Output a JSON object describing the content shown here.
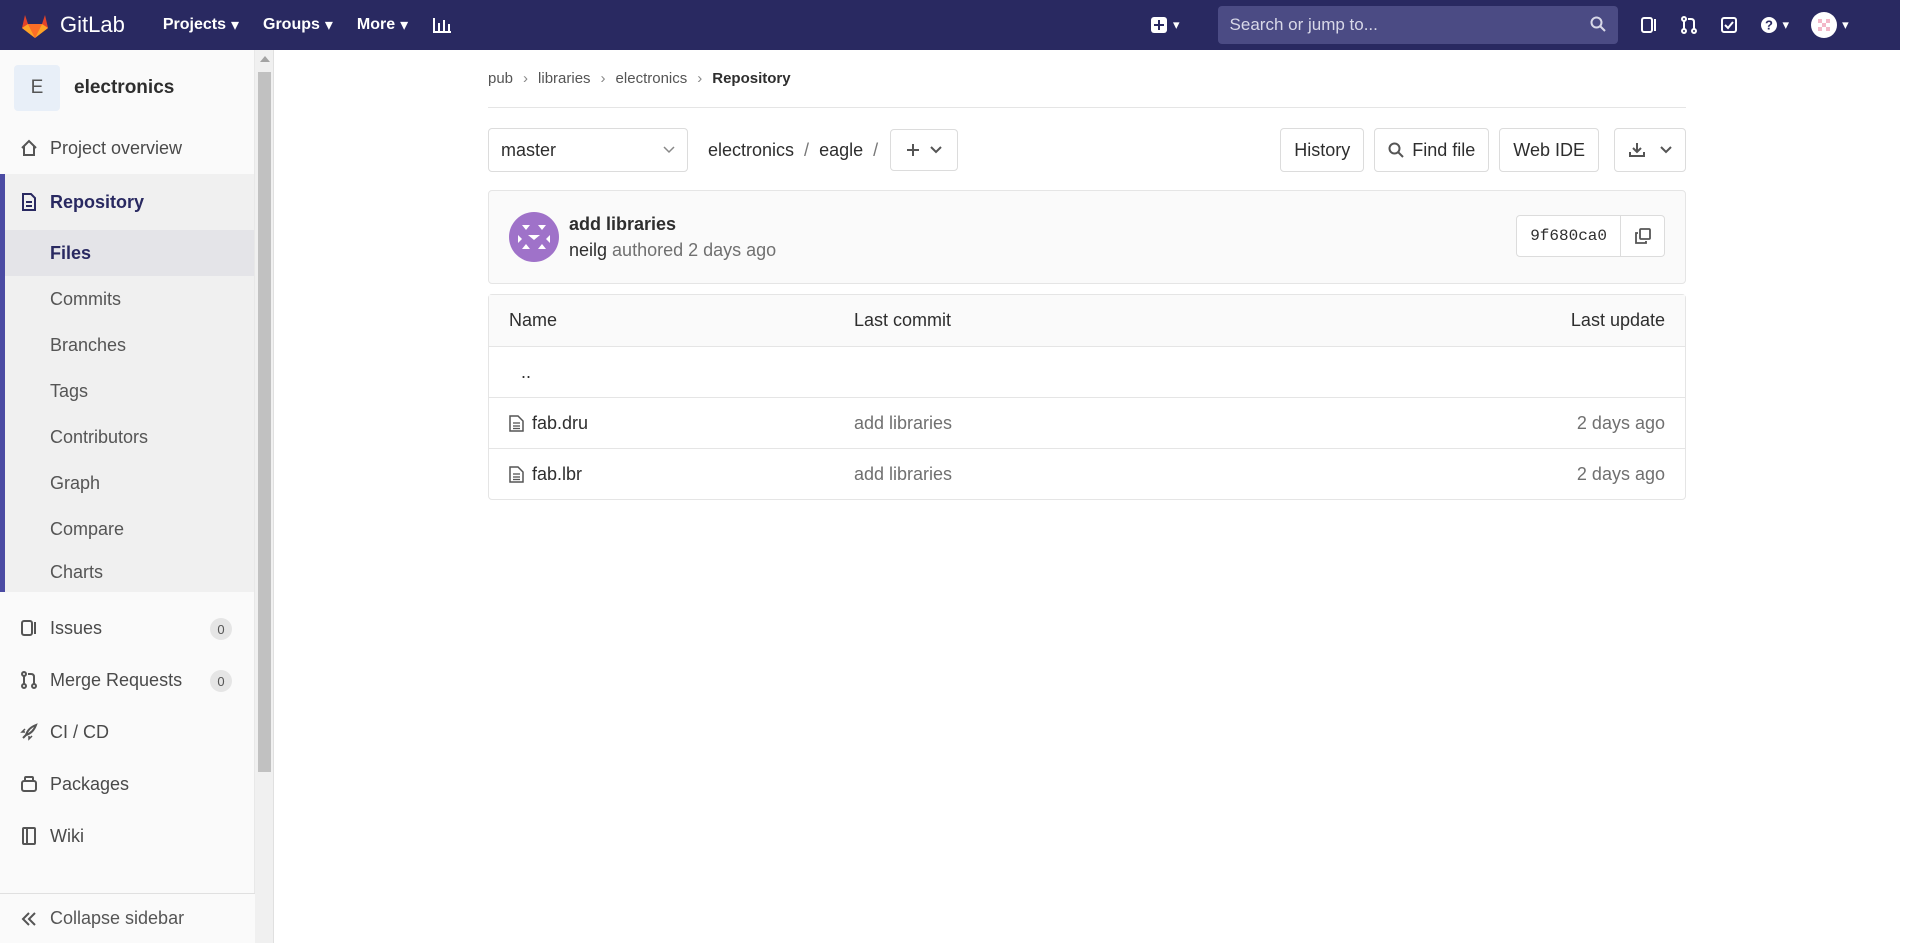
{
  "topnav": {
    "brand": "GitLab",
    "links": [
      {
        "label": "Projects"
      },
      {
        "label": "Groups"
      },
      {
        "label": "More"
      }
    ],
    "search_placeholder": "Search or jump to...",
    "colors": {
      "nav_bg": "#292961",
      "logo_orange": "#e24329"
    }
  },
  "sidebar": {
    "project_initial": "E",
    "project_name": "electronics",
    "overview": "Project overview",
    "repository": "Repository",
    "repo_items": [
      "Files",
      "Commits",
      "Branches",
      "Tags",
      "Contributors",
      "Graph",
      "Compare",
      "Charts"
    ],
    "issues": {
      "label": "Issues",
      "count": "0"
    },
    "merge_requests": {
      "label": "Merge Requests",
      "count": "0"
    },
    "cicd": "CI / CD",
    "packages": "Packages",
    "wiki": "Wiki",
    "collapse": "Collapse sidebar"
  },
  "breadcrumb": [
    "pub",
    "libraries",
    "electronics",
    "Repository"
  ],
  "toolbar": {
    "branch": "master",
    "path": [
      "electronics",
      "eagle"
    ],
    "history": "History",
    "find_file": "Find file",
    "web_ide": "Web IDE"
  },
  "commit": {
    "title": "add libraries",
    "author": "neilg",
    "authored": "authored",
    "time": "2 days ago",
    "sha": "9f680ca0"
  },
  "files": {
    "headers": {
      "name": "Name",
      "last_commit": "Last commit",
      "last_update": "Last update"
    },
    "parent": "..",
    "rows": [
      {
        "name": "fab.dru",
        "commit": "add libraries",
        "updated": "2 days ago"
      },
      {
        "name": "fab.lbr",
        "commit": "add libraries",
        "updated": "2 days ago"
      }
    ]
  }
}
